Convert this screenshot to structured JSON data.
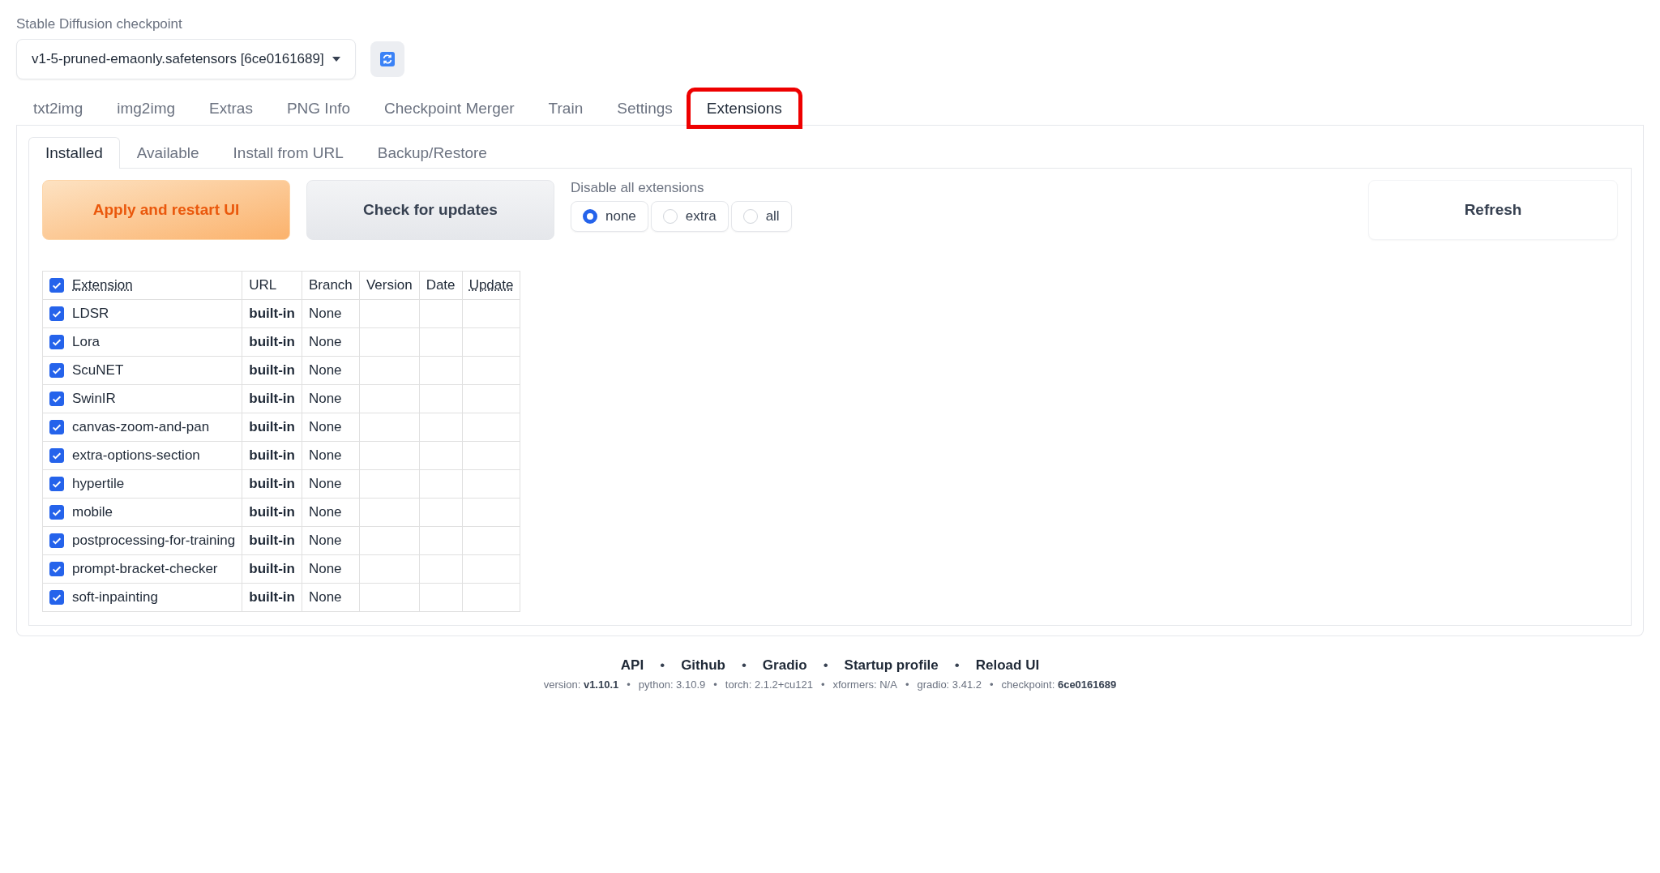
{
  "checkpoint": {
    "label": "Stable Diffusion checkpoint",
    "value": "v1-5-pruned-emaonly.safetensors [6ce0161689]"
  },
  "tabs": [
    {
      "label": "txt2img",
      "selected": false,
      "highlighted": false
    },
    {
      "label": "img2img",
      "selected": false,
      "highlighted": false
    },
    {
      "label": "Extras",
      "selected": false,
      "highlighted": false
    },
    {
      "label": "PNG Info",
      "selected": false,
      "highlighted": false
    },
    {
      "label": "Checkpoint Merger",
      "selected": false,
      "highlighted": false
    },
    {
      "label": "Train",
      "selected": false,
      "highlighted": false
    },
    {
      "label": "Settings",
      "selected": false,
      "highlighted": false
    },
    {
      "label": "Extensions",
      "selected": true,
      "highlighted": true
    }
  ],
  "subtabs": [
    {
      "label": "Installed",
      "selected": true
    },
    {
      "label": "Available",
      "selected": false
    },
    {
      "label": "Install from URL",
      "selected": false
    },
    {
      "label": "Backup/Restore",
      "selected": false
    }
  ],
  "buttons": {
    "apply": "Apply and restart UI",
    "check": "Check for updates",
    "refresh": "Refresh"
  },
  "disable_all": {
    "label": "Disable all extensions",
    "options": [
      {
        "label": "none",
        "selected": true
      },
      {
        "label": "extra",
        "selected": false
      },
      {
        "label": "all",
        "selected": false
      }
    ]
  },
  "table": {
    "select_all_checked": true,
    "columns": [
      "Extension",
      "URL",
      "Branch",
      "Version",
      "Date",
      "Update"
    ],
    "rows": [
      {
        "name": "LDSR",
        "checked": true,
        "url": "built-in",
        "branch": "None"
      },
      {
        "name": "Lora",
        "checked": true,
        "url": "built-in",
        "branch": "None"
      },
      {
        "name": "ScuNET",
        "checked": true,
        "url": "built-in",
        "branch": "None"
      },
      {
        "name": "SwinIR",
        "checked": true,
        "url": "built-in",
        "branch": "None"
      },
      {
        "name": "canvas-zoom-and-pan",
        "checked": true,
        "url": "built-in",
        "branch": "None"
      },
      {
        "name": "extra-options-section",
        "checked": true,
        "url": "built-in",
        "branch": "None"
      },
      {
        "name": "hypertile",
        "checked": true,
        "url": "built-in",
        "branch": "None"
      },
      {
        "name": "mobile",
        "checked": true,
        "url": "built-in",
        "branch": "None"
      },
      {
        "name": "postprocessing-for-training",
        "checked": true,
        "url": "built-in",
        "branch": "None"
      },
      {
        "name": "prompt-bracket-checker",
        "checked": true,
        "url": "built-in",
        "branch": "None"
      },
      {
        "name": "soft-inpainting",
        "checked": true,
        "url": "built-in",
        "branch": "None"
      }
    ]
  },
  "footer": {
    "separator": "•",
    "links": [
      "API",
      "Github",
      "Gradio",
      "Startup profile",
      "Reload UI"
    ],
    "versions": [
      "version: **v1.10.1**",
      "python: 3.10.9",
      "torch: 2.1.2+cu121",
      "xformers: N/A",
      "gradio: 3.41.2",
      "checkpoint: **6ce0161689**"
    ]
  }
}
